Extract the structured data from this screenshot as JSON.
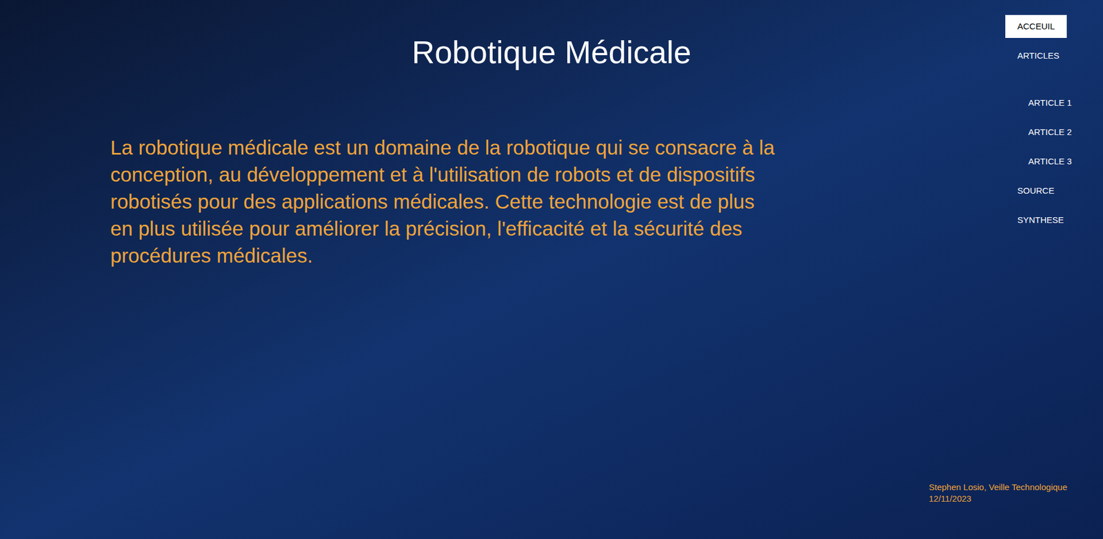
{
  "page": {
    "title": "Robotique Médicale",
    "intro": "La robotique médicale est un domaine de la robotique qui se consacre à la conception, au développement et à l'utilisation de robots et de dispositifs robotisés pour des applications médicales. Cette technologie est de plus en plus utilisée pour améliorer la précision, l'efficacité et la sécurité des procédures médicales."
  },
  "nav": {
    "items": [
      {
        "label": "ACCEUIL",
        "kind": "link",
        "selected": true
      },
      {
        "label": "ARTICLES",
        "kind": "link",
        "selected": false
      },
      {
        "label": "ARTICLE 1",
        "kind": "sublink",
        "selected": false
      },
      {
        "label": "ARTICLE 2",
        "kind": "sublink",
        "selected": false
      },
      {
        "label": "ARTICLE 3",
        "kind": "sublink",
        "selected": false
      },
      {
        "label": "SOURCE",
        "kind": "link",
        "selected": false
      },
      {
        "label": "SYNTHESE",
        "kind": "link",
        "selected": false
      }
    ]
  },
  "footer": {
    "lines": [
      "Stephen Losio, Veille Technologique",
      "12/11/2023"
    ]
  }
}
